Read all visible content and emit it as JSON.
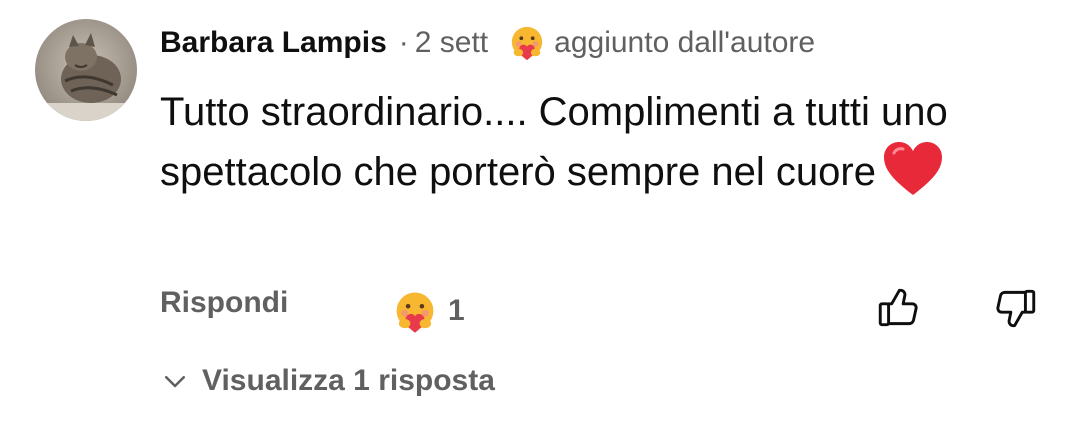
{
  "comment": {
    "author": "Barbara Lampis",
    "separator": "·",
    "time_ago": "2 sett",
    "badge_icon": "hugging-face-emoji",
    "added_by_author": "aggiunto dall'autore",
    "text": "Tutto straordinario.... Complimenti a tutti uno spettacolo che porterò sempre nel cuore",
    "text_emoji": "red-heart-emoji"
  },
  "actions": {
    "reply_label": "Rispondi",
    "reaction_icon": "hugging-face-emoji",
    "reaction_count": "1",
    "like_icon": "thumbs-up-icon",
    "dislike_icon": "thumbs-down-icon"
  },
  "replies": {
    "view_label": "Visualizza 1 risposta",
    "chevron_icon": "chevron-down-icon"
  },
  "colors": {
    "primary_text": "#0f0f0f",
    "secondary_text": "#606060",
    "heart": "#e8293a",
    "emoji_face": "#f7b731",
    "emoji_heart": "#e83a4a"
  }
}
